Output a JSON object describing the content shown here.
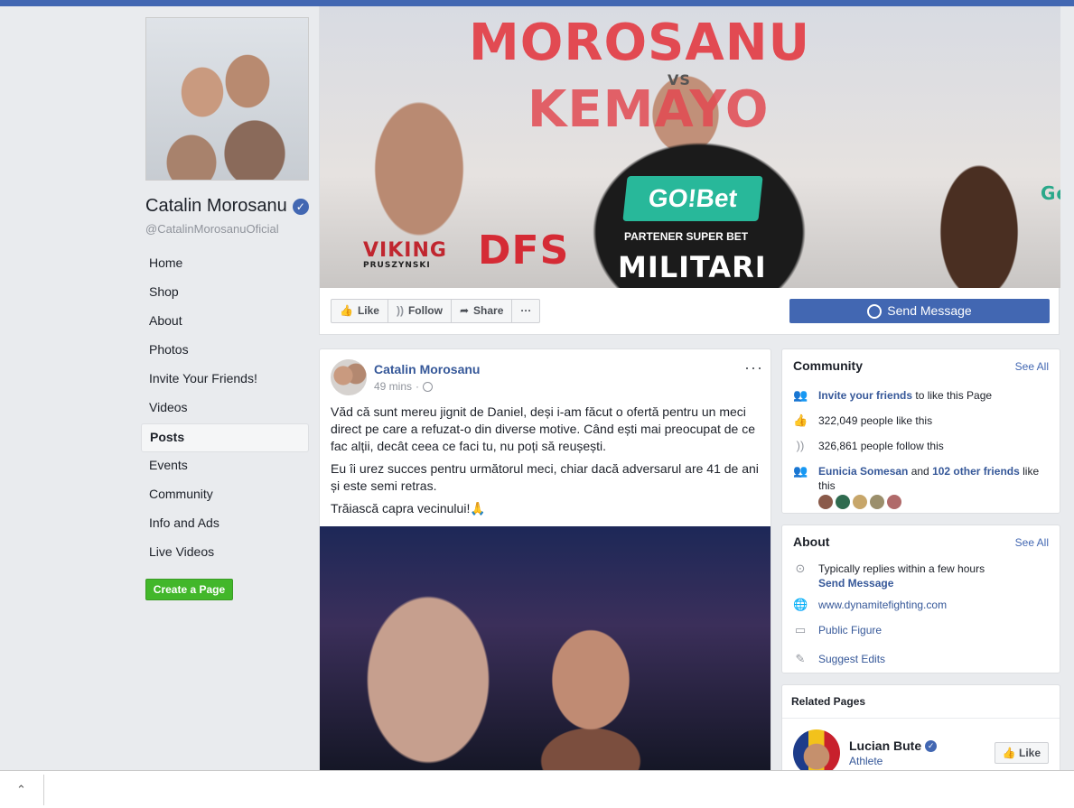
{
  "page": {
    "name": "Catalin Morosanu",
    "username": "@CatalinMorosanuOficial",
    "verified_mark": "✓"
  },
  "nav": [
    "Home",
    "Shop",
    "About",
    "Photos",
    "Invite Your Friends!",
    "Videos",
    "Posts",
    "Events",
    "Community",
    "Info and Ads",
    "Live Videos"
  ],
  "nav_active": "Posts",
  "create_page_label": "Create a Page",
  "cover": {
    "headline": "MOROSANU",
    "sub": "VS",
    "opponent": "KEMAYO",
    "sponsor": "GO!Bet",
    "sponsor_tag": "PARTENER SUPER BET",
    "shirt": "MILITARI",
    "banner_left": "VIKING",
    "banner_left_sub": "PRUSZYNSKI",
    "banner_mid": "DFS",
    "banner_right": "Gé"
  },
  "actions": {
    "like": "Like",
    "follow": "Follow",
    "share": "Share",
    "more": "···",
    "send_message": "Send Message"
  },
  "post": {
    "author": "Catalin Morosanu",
    "time": "49 mins",
    "time_sep": "·",
    "more": "···",
    "paragraphs": [
      "Văd că sunt mereu jignit de Daniel, deși i-am făcut o ofertă pentru un meci direct pe care a refuzat-o din diverse motive. Când ești mai preocupat de ce fac alții, decât ceea ce faci tu, nu poți să reușești.",
      "Eu îi urez succes pentru următorul meci, chiar dacă adversarul are 41 de ani și este semi retras.",
      "Trăiască capra vecinului!🙏"
    ]
  },
  "community": {
    "title": "Community",
    "see_all": "See All",
    "invite_link": "Invite your friends",
    "invite_rest": " to like this Page",
    "likes": "322,049 people like this",
    "follows": "326,861 people follow this",
    "friend_name": "Eunicia Somesan",
    "friend_and": " and ",
    "friend_other": "102 other friends",
    "friend_rest": " like this",
    "friend_colors": [
      "#8a5a4a",
      "#2f6b4f",
      "#c7a66a",
      "#9b8f6c",
      "#b06a6a"
    ]
  },
  "about": {
    "title": "About",
    "see_all": "See All",
    "replies": "Typically replies within a few hours",
    "send_message": "Send Message",
    "website": "www.dynamitefighting.com",
    "category": "Public Figure",
    "suggest": "Suggest Edits"
  },
  "related": {
    "title": "Related Pages",
    "name": "Lucian Bute",
    "category": "Athlete",
    "like": "Like"
  },
  "colors": {
    "brand": "#4267b2",
    "link": "#365899",
    "green": "#42b72a",
    "background": "#e9ebee"
  }
}
